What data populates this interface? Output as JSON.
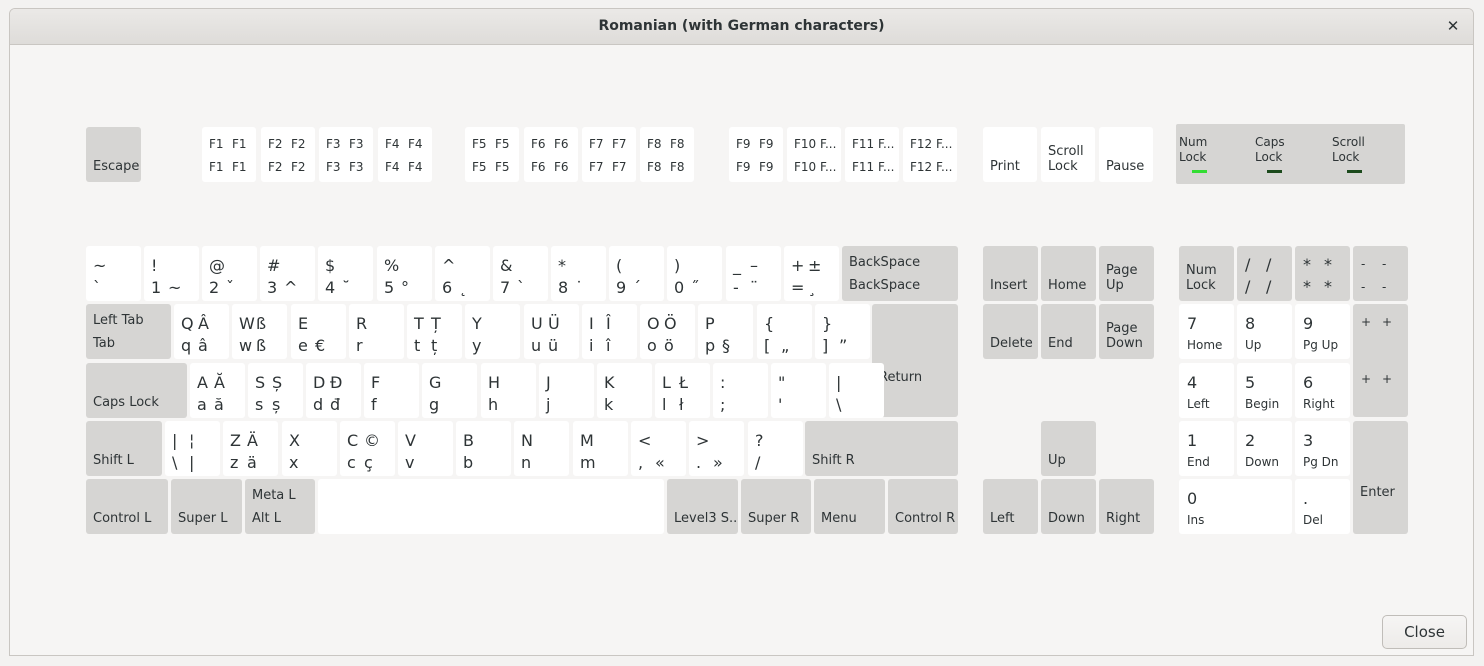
{
  "window": {
    "title": "Romanian (with German characters)",
    "close_icon": "✕"
  },
  "footer": {
    "close_label": "Close"
  },
  "leds": {
    "items": [
      {
        "label_lines": [
          "Num",
          "Lock"
        ],
        "color": "#33dd33"
      },
      {
        "label_lines": [
          "Caps",
          "Lock"
        ],
        "color": "#1c4a1c"
      },
      {
        "label_lines": [
          "Scroll",
          "Lock"
        ],
        "color": "#1c4a1c"
      }
    ]
  },
  "rows": {
    "function": [
      {
        "name": "escape",
        "label": "Escape"
      },
      {
        "name": "f1",
        "levels": [
          "F1",
          "F1",
          "F1",
          "F1"
        ]
      },
      {
        "name": "f2",
        "levels": [
          "F2",
          "F2",
          "F2",
          "F2"
        ]
      },
      {
        "name": "f3",
        "levels": [
          "F3",
          "F3",
          "F3",
          "F3"
        ]
      },
      {
        "name": "f4",
        "levels": [
          "F4",
          "F4",
          "F4",
          "F4"
        ]
      },
      {
        "name": "f5",
        "levels": [
          "F5",
          "F5",
          "F5",
          "F5"
        ]
      },
      {
        "name": "f6",
        "levels": [
          "F6",
          "F6",
          "F6",
          "F6"
        ]
      },
      {
        "name": "f7",
        "levels": [
          "F7",
          "F7",
          "F7",
          "F7"
        ]
      },
      {
        "name": "f8",
        "levels": [
          "F8",
          "F8",
          "F8",
          "F8"
        ]
      },
      {
        "name": "f9",
        "levels": [
          "F9",
          "F9",
          "F9",
          "F9"
        ]
      },
      {
        "name": "f10",
        "levels": [
          "F10 F...",
          "",
          "F10 F...",
          ""
        ]
      },
      {
        "name": "f11",
        "levels": [
          "F11 F...",
          "",
          "F11 F...",
          ""
        ]
      },
      {
        "name": "f12",
        "levels": [
          "F12 F...",
          "",
          "F12 F...",
          ""
        ]
      },
      {
        "name": "print",
        "label": "Print"
      },
      {
        "name": "scroll-lock",
        "label": "Scroll\nLock"
      },
      {
        "name": "pause",
        "label": "Pause"
      }
    ],
    "number": [
      {
        "name": "grave",
        "levels": [
          "~",
          "",
          "`",
          ""
        ]
      },
      {
        "name": "1",
        "levels": [
          "!",
          "",
          "1",
          "~"
        ]
      },
      {
        "name": "2",
        "levels": [
          "@",
          "",
          "2",
          "ˇ"
        ]
      },
      {
        "name": "3",
        "levels": [
          "#",
          "",
          "3",
          "^"
        ]
      },
      {
        "name": "4",
        "levels": [
          "$",
          "",
          "4",
          "˘"
        ]
      },
      {
        "name": "5",
        "levels": [
          "%",
          "",
          "5",
          "°"
        ]
      },
      {
        "name": "6",
        "levels": [
          "^",
          "",
          "6",
          "˛"
        ]
      },
      {
        "name": "7",
        "levels": [
          "&",
          "",
          "7",
          "`"
        ]
      },
      {
        "name": "8",
        "levels": [
          "*",
          "",
          "8",
          "˙"
        ]
      },
      {
        "name": "9",
        "levels": [
          "(",
          "",
          "9",
          "´"
        ]
      },
      {
        "name": "0",
        "levels": [
          ")",
          "",
          "0",
          "˝"
        ]
      },
      {
        "name": "minus",
        "levels": [
          "_",
          "–",
          "-",
          "¨"
        ]
      },
      {
        "name": "equal",
        "levels": [
          "+",
          "±",
          "=",
          "¸"
        ]
      },
      {
        "name": "backspace",
        "label": "BackSpace\nBackSpace"
      }
    ],
    "top": [
      {
        "name": "tab",
        "label": "Left Tab\nTab"
      },
      {
        "name": "q",
        "levels": [
          "Q",
          "Â",
          "q",
          "â"
        ]
      },
      {
        "name": "w",
        "levels": [
          "W",
          "ß",
          "w",
          "ß"
        ]
      },
      {
        "name": "e",
        "levels": [
          "E",
          "",
          "e",
          "€"
        ]
      },
      {
        "name": "r",
        "levels": [
          "R",
          "",
          "r",
          ""
        ]
      },
      {
        "name": "t",
        "levels": [
          "T",
          "Ț",
          "t",
          "ț"
        ]
      },
      {
        "name": "y",
        "levels": [
          "Y",
          "",
          "y",
          ""
        ]
      },
      {
        "name": "u",
        "levels": [
          "U",
          "Ü",
          "u",
          "ü"
        ]
      },
      {
        "name": "i",
        "levels": [
          "I",
          "Î",
          "i",
          "î"
        ]
      },
      {
        "name": "o",
        "levels": [
          "O",
          "Ö",
          "o",
          "ö"
        ]
      },
      {
        "name": "p",
        "levels": [
          "P",
          "",
          "p",
          "§"
        ]
      },
      {
        "name": "bracketleft",
        "levels": [
          "{",
          "",
          "[",
          "„"
        ]
      },
      {
        "name": "bracketright",
        "levels": [
          "}",
          "",
          "]",
          "”"
        ]
      },
      {
        "name": "return",
        "label": "Return"
      }
    ],
    "home": [
      {
        "name": "caps-lock",
        "label": "Caps Lock"
      },
      {
        "name": "a",
        "levels": [
          "A",
          "Ă",
          "a",
          "ă"
        ]
      },
      {
        "name": "s",
        "levels": [
          "S",
          "Ș",
          "s",
          "ș"
        ]
      },
      {
        "name": "d",
        "levels": [
          "D",
          "Đ",
          "d",
          "đ"
        ]
      },
      {
        "name": "f",
        "levels": [
          "F",
          "",
          "f",
          ""
        ]
      },
      {
        "name": "g",
        "levels": [
          "G",
          "",
          "g",
          ""
        ]
      },
      {
        "name": "h",
        "levels": [
          "H",
          "",
          "h",
          ""
        ]
      },
      {
        "name": "j",
        "levels": [
          "J",
          "",
          "j",
          ""
        ]
      },
      {
        "name": "k",
        "levels": [
          "K",
          "",
          "k",
          ""
        ]
      },
      {
        "name": "l",
        "levels": [
          "L",
          "Ł",
          "l",
          "ł"
        ]
      },
      {
        "name": "semicolon",
        "levels": [
          ":",
          "",
          ";",
          ""
        ]
      },
      {
        "name": "apostrophe",
        "levels": [
          "\"",
          "",
          "'",
          ""
        ]
      },
      {
        "name": "backslash",
        "levels": [
          "|",
          "",
          "\\",
          ""
        ]
      }
    ],
    "bottom": [
      {
        "name": "shift-l",
        "label": "Shift L"
      },
      {
        "name": "less",
        "levels": [
          "|",
          "¦",
          "\\",
          "|"
        ]
      },
      {
        "name": "z",
        "levels": [
          "Z",
          "Ä",
          "z",
          "ä"
        ]
      },
      {
        "name": "x",
        "levels": [
          "X",
          "",
          "x",
          ""
        ]
      },
      {
        "name": "c",
        "levels": [
          "C",
          "©",
          "c",
          "ç"
        ]
      },
      {
        "name": "v",
        "levels": [
          "V",
          "",
          "v",
          ""
        ]
      },
      {
        "name": "b",
        "levels": [
          "B",
          "",
          "b",
          ""
        ]
      },
      {
        "name": "n",
        "levels": [
          "N",
          "",
          "n",
          ""
        ]
      },
      {
        "name": "m",
        "levels": [
          "M",
          "",
          "m",
          ""
        ]
      },
      {
        "name": "comma",
        "levels": [
          "<",
          "",
          ",",
          "«"
        ]
      },
      {
        "name": "period",
        "levels": [
          ">",
          "",
          ".",
          "»"
        ]
      },
      {
        "name": "slash",
        "levels": [
          "?",
          "",
          "/",
          ""
        ]
      },
      {
        "name": "shift-r",
        "label": "Shift R"
      }
    ],
    "space": [
      {
        "name": "control-l",
        "label": "Control L"
      },
      {
        "name": "super-l",
        "label": "Super L"
      },
      {
        "name": "alt-l",
        "label": "Meta L\nAlt L"
      },
      {
        "name": "space",
        "label": ""
      },
      {
        "name": "level3",
        "label": "Level3 S..."
      },
      {
        "name": "super-r",
        "label": "Super R"
      },
      {
        "name": "menu",
        "label": "Menu"
      },
      {
        "name": "control-r",
        "label": "Control R"
      }
    ]
  },
  "nav": [
    {
      "name": "insert",
      "label": "Insert"
    },
    {
      "name": "home",
      "label": "Home"
    },
    {
      "name": "page-up",
      "label": "Page\nUp"
    },
    {
      "name": "delete",
      "label": "Delete"
    },
    {
      "name": "end",
      "label": "End"
    },
    {
      "name": "page-down",
      "label": "Page\nDown"
    },
    {
      "name": "up",
      "label": "Up"
    },
    {
      "name": "left",
      "label": "Left"
    },
    {
      "name": "down",
      "label": "Down"
    },
    {
      "name": "right",
      "label": "Right"
    }
  ],
  "numpad": [
    {
      "name": "kp-numlock",
      "label": "Num\nLock"
    },
    {
      "name": "kp-divide",
      "levels": [
        "/",
        "/",
        "/",
        "/"
      ]
    },
    {
      "name": "kp-multiply",
      "levels": [
        "*",
        "*",
        "*",
        "*"
      ]
    },
    {
      "name": "kp-subtract",
      "levels": [
        "-",
        "-",
        "-",
        "-"
      ]
    },
    {
      "name": "kp-7",
      "digit": "7",
      "sub": "Home"
    },
    {
      "name": "kp-8",
      "digit": "8",
      "sub": "Up"
    },
    {
      "name": "kp-9",
      "digit": "9",
      "sub": "Pg Up"
    },
    {
      "name": "kp-add",
      "levels": [
        "+",
        "+",
        "+",
        "+"
      ]
    },
    {
      "name": "kp-4",
      "digit": "4",
      "sub": "Left"
    },
    {
      "name": "kp-5",
      "digit": "5",
      "sub": "Begin"
    },
    {
      "name": "kp-6",
      "digit": "6",
      "sub": "Right"
    },
    {
      "name": "kp-1",
      "digit": "1",
      "sub": "End"
    },
    {
      "name": "kp-2",
      "digit": "2",
      "sub": "Down"
    },
    {
      "name": "kp-3",
      "digit": "3",
      "sub": "Pg Dn"
    },
    {
      "name": "kp-enter",
      "label": "Enter"
    },
    {
      "name": "kp-0",
      "digit": "0",
      "sub": "Ins"
    },
    {
      "name": "kp-decimal",
      "digit": ".",
      "sub": "Del"
    }
  ]
}
